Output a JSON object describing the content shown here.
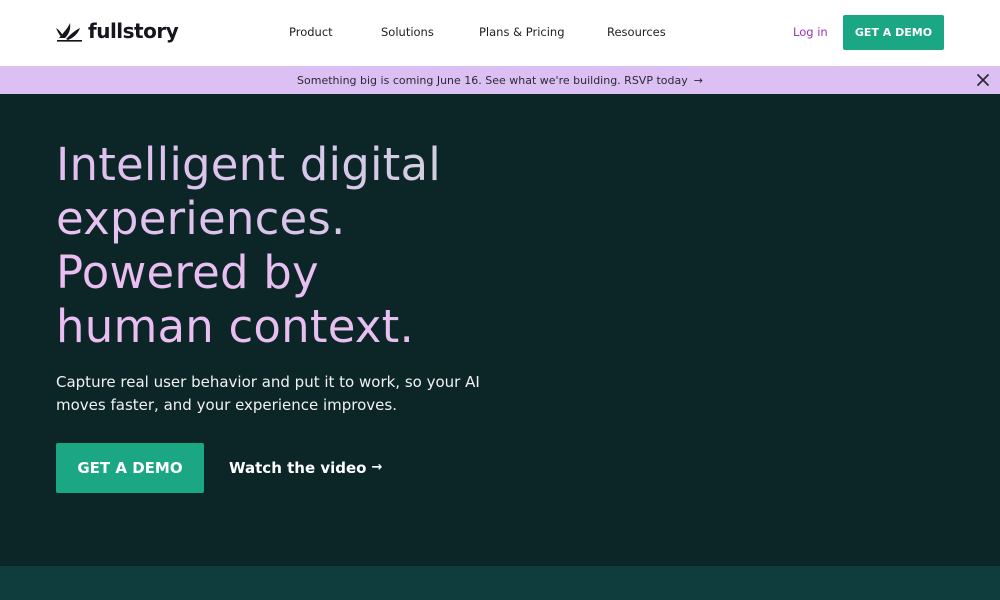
{
  "header": {
    "brand": "fullstory",
    "nav": [
      {
        "label": "Product"
      },
      {
        "label": "Solutions"
      },
      {
        "label": "Plans & Pricing"
      },
      {
        "label": "Resources"
      }
    ],
    "login_label": "Log in",
    "demo_label": "GET A DEMO"
  },
  "banner": {
    "text": "Something big is coming June 16. See what we're building. RSVP today",
    "arrow": "→",
    "close_icon": "close-icon"
  },
  "hero": {
    "headline_lines": [
      "Intelligent digital",
      "experiences.",
      "Powered by",
      "human context."
    ],
    "subtext": "Capture real user behavior and put it to work, so your AI moves faster, and your experience improves.",
    "demo_label": "GET A DEMO",
    "watch_label": "Watch the video",
    "watch_arrow": "→"
  },
  "colors": {
    "accent_green": "#1ba783",
    "banner_bg": "#dcc0f3",
    "hero_bg": "#0c2628",
    "login_purple": "#9b35b8"
  }
}
